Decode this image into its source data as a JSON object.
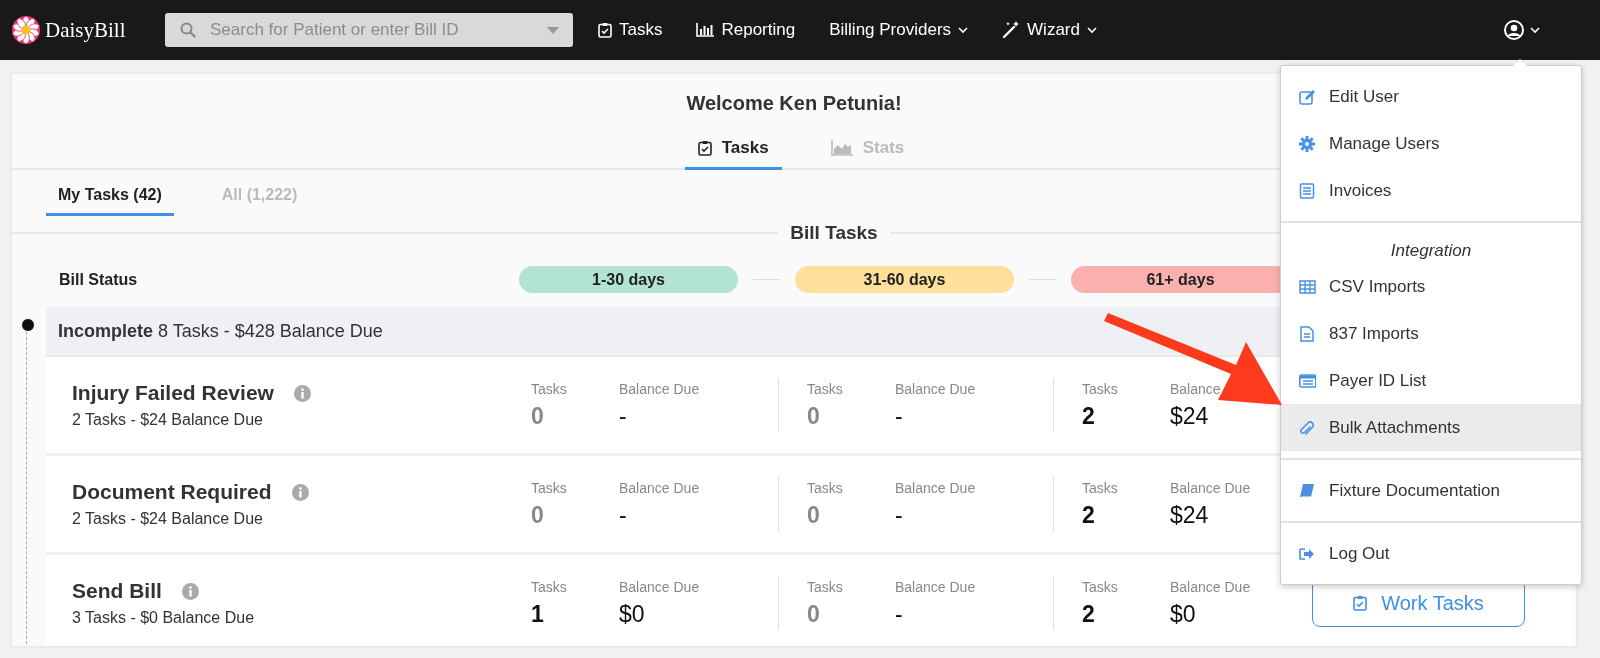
{
  "navbar": {
    "brand": "DaisyBill",
    "search": {
      "placeholder": "Search for Patient or enter Bill ID"
    },
    "items": [
      {
        "kind": "tasks",
        "label": "Tasks",
        "dropdown": false
      },
      {
        "kind": "reporting",
        "label": "Reporting",
        "dropdown": false
      },
      {
        "kind": "plain",
        "label": "Billing Providers",
        "dropdown": true
      },
      {
        "kind": "wizard",
        "label": "Wizard",
        "dropdown": true
      }
    ]
  },
  "welcome": "Welcome Ken Petunia!",
  "view_tabs": [
    {
      "kind": "tasks",
      "label": "Tasks",
      "selected": true
    },
    {
      "kind": "stats",
      "label": "Stats",
      "selected": false
    }
  ],
  "task_tabs": [
    {
      "label": "My Tasks (42)",
      "selected": true
    },
    {
      "label": "All (1,222)",
      "selected": false
    }
  ],
  "section_title": "Bill Tasks",
  "status_label": "Bill Status",
  "age_buckets": [
    {
      "label": "1-30 days",
      "color": "#b3e3d1"
    },
    {
      "label": "31-60 days",
      "color": "#ffe09a"
    },
    {
      "label": "61+ days",
      "color": "#fbb0b0"
    }
  ],
  "group": {
    "name": "Incomplete",
    "summary": "8 Tasks - $428 Balance Due"
  },
  "rows": [
    {
      "title": "Injury Failed Review",
      "summary": "2 Tasks - $24 Balance Due",
      "buckets": [
        {
          "tasks_label": "Tasks",
          "tasks": "0",
          "dimmed": true,
          "balance_label": "Balance Due",
          "balance": "-"
        },
        {
          "tasks_label": "Tasks",
          "tasks": "0",
          "dimmed": true,
          "balance_label": "Balance Due",
          "balance": "-"
        },
        {
          "tasks_label": "Tasks",
          "tasks": "2",
          "dimmed": false,
          "balance_label": "Balance",
          "balance": "$24"
        }
      ]
    },
    {
      "title": "Document Required",
      "summary": "2 Tasks - $24 Balance Due",
      "buckets": [
        {
          "tasks_label": "Tasks",
          "tasks": "0",
          "dimmed": true,
          "balance_label": "Balance Due",
          "balance": "-"
        },
        {
          "tasks_label": "Tasks",
          "tasks": "0",
          "dimmed": true,
          "balance_label": "Balance Due",
          "balance": "-"
        },
        {
          "tasks_label": "Tasks",
          "tasks": "2",
          "dimmed": false,
          "balance_label": "Balance Due",
          "balance": "$24"
        }
      ]
    },
    {
      "title": "Send Bill",
      "summary": "3 Tasks - $0 Balance Due",
      "action": "Work Tasks",
      "buckets": [
        {
          "tasks_label": "Tasks",
          "tasks": "1",
          "dimmed": false,
          "balance_label": "Balance Due",
          "balance": "$0"
        },
        {
          "tasks_label": "Tasks",
          "tasks": "0",
          "dimmed": true,
          "balance_label": "Balance Due",
          "balance": "-"
        },
        {
          "tasks_label": "Tasks",
          "tasks": "2",
          "dimmed": false,
          "balance_label": "Balance Due",
          "balance": "$0"
        }
      ]
    }
  ],
  "user_menu": {
    "sections": [
      {
        "items": [
          {
            "kind": "edit",
            "label": "Edit User",
            "selected": false
          },
          {
            "kind": "gear",
            "label": "Manage Users",
            "selected": false
          },
          {
            "kind": "invoice",
            "label": "Invoices",
            "selected": false
          }
        ]
      },
      {
        "header": "Integration",
        "items": [
          {
            "kind": "table",
            "label": "CSV Imports",
            "selected": false
          },
          {
            "kind": "file",
            "label": "837 Imports",
            "selected": false
          },
          {
            "kind": "list",
            "label": "Payer ID List",
            "selected": false
          },
          {
            "kind": "clip",
            "label": "Bulk Attachments",
            "selected": true
          }
        ]
      },
      {
        "items": [
          {
            "kind": "book",
            "label": "Fixture Documentation",
            "selected": false
          }
        ]
      },
      {
        "items": [
          {
            "kind": "logout",
            "label": "Log Out",
            "selected": false
          }
        ]
      }
    ]
  }
}
